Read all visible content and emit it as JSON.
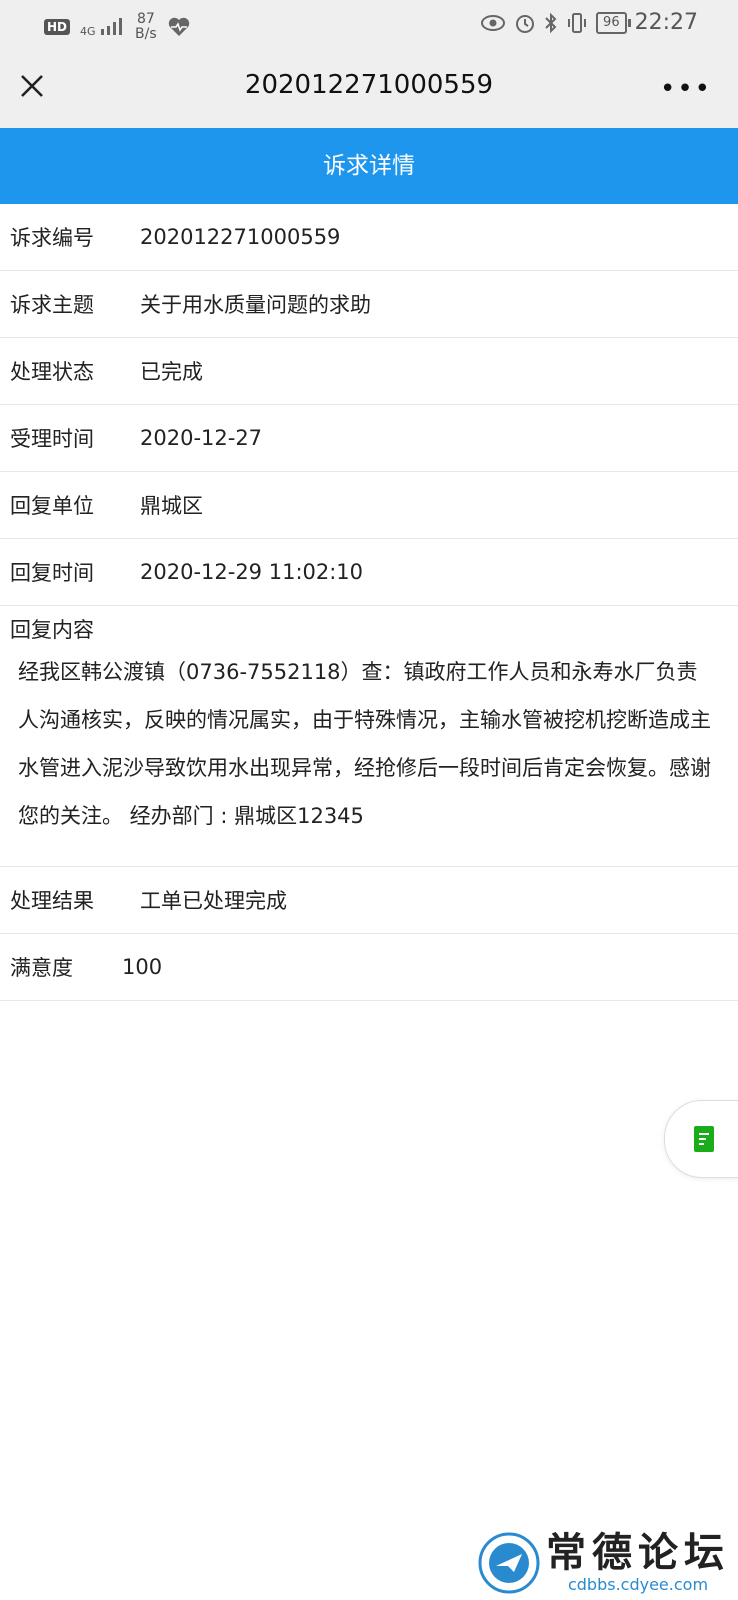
{
  "status_bar": {
    "hd": "HD",
    "network": "4G",
    "speed_value": "87",
    "speed_unit": "B/s",
    "battery": "96",
    "time": "22:27"
  },
  "nav": {
    "title": "202012271000559",
    "more": "•••"
  },
  "header": {
    "title": "诉求详情"
  },
  "details": {
    "id_label": "诉求编号",
    "id_value": "202012271000559",
    "subject_label": "诉求主题",
    "subject_value": "关于用水质量问题的求助",
    "status_label": "处理状态",
    "status_value": "已完成",
    "accepted_label": "受理时间",
    "accepted_value": "2020-12-27",
    "reply_unit_label": "回复单位",
    "reply_unit_value": "鼎城区",
    "reply_time_label": "回复时间",
    "reply_time_value": "2020-12-29 11:02:10",
    "reply_content_label": "回复内容",
    "reply_content_value": "经我区韩公渡镇（0736-7552118）查：镇政府工作人员和永寿水厂负责人沟通核实，反映的情况属实，由于特殊情况，主输水管被挖机挖断造成主水管进入泥沙导致饮用水出现异常，经抢修后一段时间后肯定会恢复。感谢您的关注。 经办部门 : 鼎城区12345",
    "result_label": "处理结果",
    "result_value": "工单已处理完成",
    "satisfaction_label": "满意度",
    "satisfaction_value": "100"
  },
  "watermark": {
    "title": "常德论坛",
    "url": "cdbbs.cdyee.com"
  },
  "colors": {
    "header_bg": "#1e96ee",
    "float_icon": "#1aad19"
  }
}
